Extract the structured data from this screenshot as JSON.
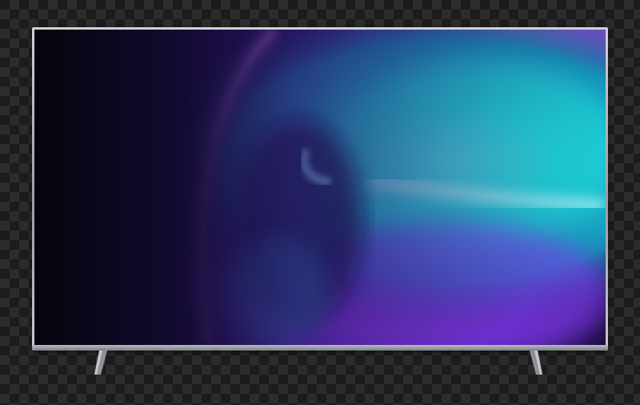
{
  "scene": {
    "background": "transparency-checkerboard",
    "object": "flat-screen-television",
    "colors": {
      "bezel": "#b8bbbf",
      "screen_dark": "#07060f",
      "violet": "#8a3cff",
      "magenta": "#d36bff",
      "cyan": "#1fe0e0",
      "teal": "#19b8c8"
    }
  }
}
